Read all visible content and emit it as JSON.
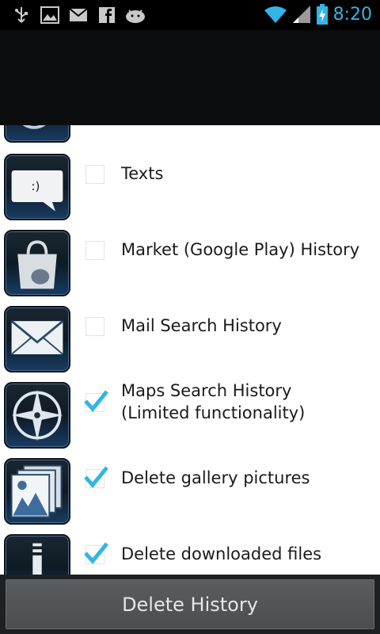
{
  "status_bar": {
    "time": "8:20",
    "notification_icons": [
      "usb-icon",
      "image-icon",
      "gmail-icon",
      "facebook-icon",
      "android-icon"
    ],
    "system_icons": [
      "wifi-icon",
      "signal-icon",
      "battery-charging-icon"
    ]
  },
  "list": {
    "items": [
      {
        "label": "Texts",
        "checked": false,
        "icon": "texts-icon"
      },
      {
        "label": "Market (Google Play) History",
        "checked": false,
        "icon": "market-icon"
      },
      {
        "label": "Mail Search History",
        "checked": false,
        "icon": "mail-icon"
      },
      {
        "label": "Maps Search History\n(Limited functionality)",
        "checked": true,
        "icon": "compass-icon"
      },
      {
        "label": "Delete gallery pictures",
        "checked": true,
        "icon": "gallery-icon"
      },
      {
        "label": "Delete downloaded files",
        "checked": true,
        "icon": "download-icon"
      }
    ]
  },
  "footer": {
    "delete_button": "Delete History"
  },
  "colors": {
    "accent": "#33b5e5",
    "check": "#33b5e5",
    "button_bg": "#55585b"
  }
}
